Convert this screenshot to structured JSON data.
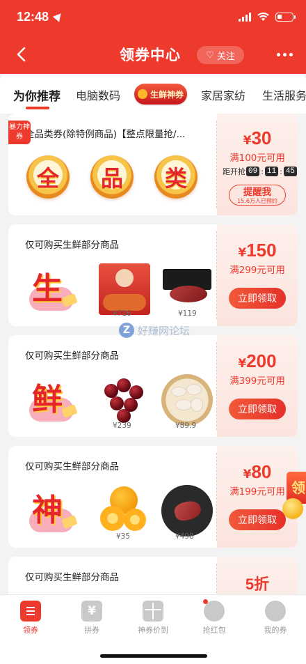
{
  "status_bar": {
    "time": "12:48"
  },
  "header": {
    "title": "领券中心",
    "follow_label": "关注"
  },
  "tabs": [
    {
      "label": "为你推荐"
    },
    {
      "label": "电脑数码"
    },
    {
      "label": "生鲜神券"
    },
    {
      "label": "家居家纺"
    },
    {
      "label": "生活服务"
    }
  ],
  "coupons": [
    {
      "badge": "暴力神券",
      "title": "全品类券(除特例商品)【整点限量抢/...",
      "medals": [
        "全",
        "品",
        "类"
      ],
      "currency": "¥",
      "amount": "30",
      "condition": "满100元可用",
      "countdown_label": "距开抢",
      "countdown": [
        "09",
        "11",
        "45"
      ],
      "button_label": "提醒我",
      "button_sub": "15.6万人已预约"
    },
    {
      "title": "仅可购买生鲜部分商品",
      "char": "生",
      "currency": "¥",
      "amount": "150",
      "condition": "满299元可用",
      "button_label": "立即领取",
      "products": [
        {
          "price": "¥716"
        },
        {
          "price": "¥119"
        }
      ]
    },
    {
      "title": "仅可购买生鲜部分商品",
      "char": "鲜",
      "currency": "¥",
      "amount": "200",
      "condition": "满399元可用",
      "button_label": "立即领取",
      "products": [
        {
          "price": "¥239"
        },
        {
          "price": "¥89.9"
        }
      ]
    },
    {
      "title": "仅可购买生鲜部分商品",
      "char": "神",
      "currency": "¥",
      "amount": "80",
      "condition": "满199元可用",
      "button_label": "立即领取",
      "products": [
        {
          "price": "¥35"
        },
        {
          "price": "¥498"
        }
      ]
    },
    {
      "title": "仅可购买生鲜部分商品",
      "amount": "5折"
    }
  ],
  "watermark": {
    "logo": "Z",
    "text": "好赚网论坛"
  },
  "floater": {
    "text": "领"
  },
  "bottom_nav": [
    {
      "label": "领券"
    },
    {
      "label": "拼券"
    },
    {
      "label": "神券价到"
    },
    {
      "label": "抢红包"
    },
    {
      "label": "我的券"
    }
  ],
  "colors": {
    "accent": "#ee3a2d",
    "coupon_bg": "#fdf0ec"
  }
}
